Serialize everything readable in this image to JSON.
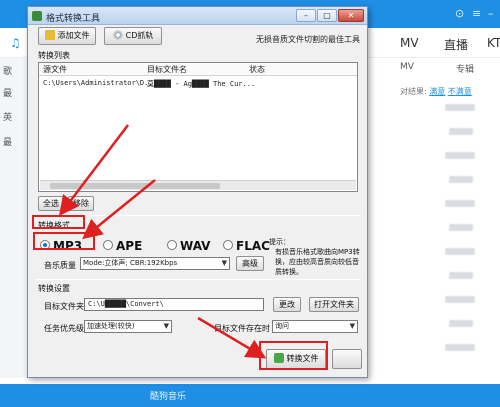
{
  "background": {
    "nav_items": [
      "MV",
      "直播",
      "KT"
    ],
    "nav_left": "♫",
    "sub_nav": [
      "MV",
      "专辑"
    ],
    "result_label": "对结果:",
    "result_link1": "满意",
    "result_link2": "不满意",
    "sidebar": [
      "歌",
      "最",
      "英",
      "最",
      "最"
    ],
    "bottom_text": "酷狗音乐"
  },
  "dialog": {
    "title": "格式转换工具",
    "add_file_button": "添加文件",
    "cd_button": "CD抓轨",
    "slogan": "无损音质文件切割的最佳工具",
    "convert_list_label": "转换列表",
    "columns": [
      "源文件",
      "目标文件名",
      "状态"
    ],
    "rows": [
      {
        "source": "C:\\Users\\Administrator\\D...",
        "target": "莫████ - Ag████ The Cur...",
        "status": ""
      }
    ],
    "select_all_button": "全选",
    "remove_button": "移除",
    "format_label": "转换格式",
    "formats": [
      {
        "label": "MP3",
        "selected": true
      },
      {
        "label": "APE",
        "selected": false
      },
      {
        "label": "WAV",
        "selected": false
      },
      {
        "label": "FLAC",
        "selected": false
      }
    ],
    "hint_title": "提示：",
    "hint_text": "有损音乐格式歌曲向MP3转换，应由较高音质向较低音质转换。",
    "quality_label": "音乐质量",
    "quality_value": "Mode:立体声; CBR:192Kbps",
    "advanced_button": "高级",
    "settings_label": "转换设置",
    "target_folder_label": "目标文件夹",
    "target_folder_value": "C:\\U█████\\Convert\\",
    "change_button": "更改",
    "open_folder_button": "打开文件夹",
    "priority_label": "任务优先级",
    "priority_value": "加速处理(较快)",
    "exists_label": "目标文件存在时",
    "exists_value": "询问",
    "convert_button": "转换文件"
  },
  "colors": {
    "accent": "#1f8fe6",
    "annotation": "#e02020"
  }
}
